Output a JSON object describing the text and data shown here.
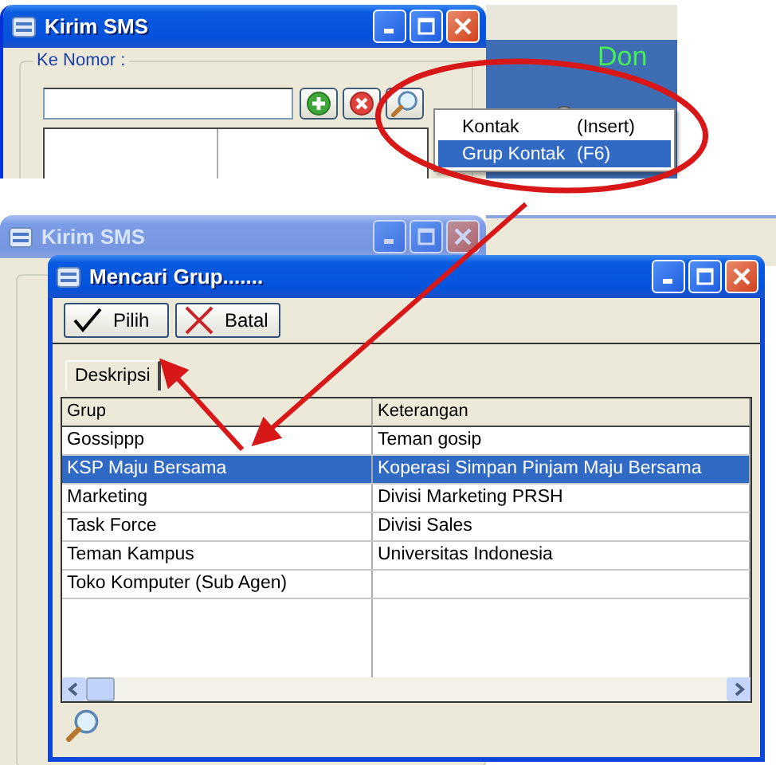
{
  "top_window": {
    "title": "Kirim SMS",
    "group_label": "Ke Nomor :"
  },
  "background_banner": {
    "text": "Don"
  },
  "popup_menu": [
    {
      "label": "Kontak",
      "shortcut": "(Insert)",
      "selected": false
    },
    {
      "label": "Grup Kontak",
      "shortcut": "(F6)",
      "selected": true
    }
  ],
  "bottom_window": {
    "title": "Kirim SMS"
  },
  "dialog": {
    "title": "Mencari Grup.......",
    "buttons": [
      {
        "label": "Pilih",
        "kind": "ok"
      },
      {
        "label": "Batal",
        "kind": "cancel"
      }
    ],
    "tabs": [
      {
        "label": "Deskripsi",
        "selected": true
      }
    ],
    "table": {
      "columns": [
        "Grup",
        "Keterangan"
      ],
      "rows": [
        {
          "cells": [
            "Gossippp",
            "Teman gosip"
          ],
          "selected": false
        },
        {
          "cells": [
            "KSP Maju Bersama",
            "Koperasi Simpan Pinjam Maju Bersama"
          ],
          "selected": true
        },
        {
          "cells": [
            "Marketing",
            "Divisi Marketing PRSH"
          ],
          "selected": false
        },
        {
          "cells": [
            "Task Force",
            "Divisi Sales"
          ],
          "selected": false
        },
        {
          "cells": [
            "Teman Kampus",
            "Universitas Indonesia"
          ],
          "selected": false
        },
        {
          "cells": [
            "Toko Komputer (Sub Agen)"
          ],
          "selected": false
        }
      ]
    }
  }
}
